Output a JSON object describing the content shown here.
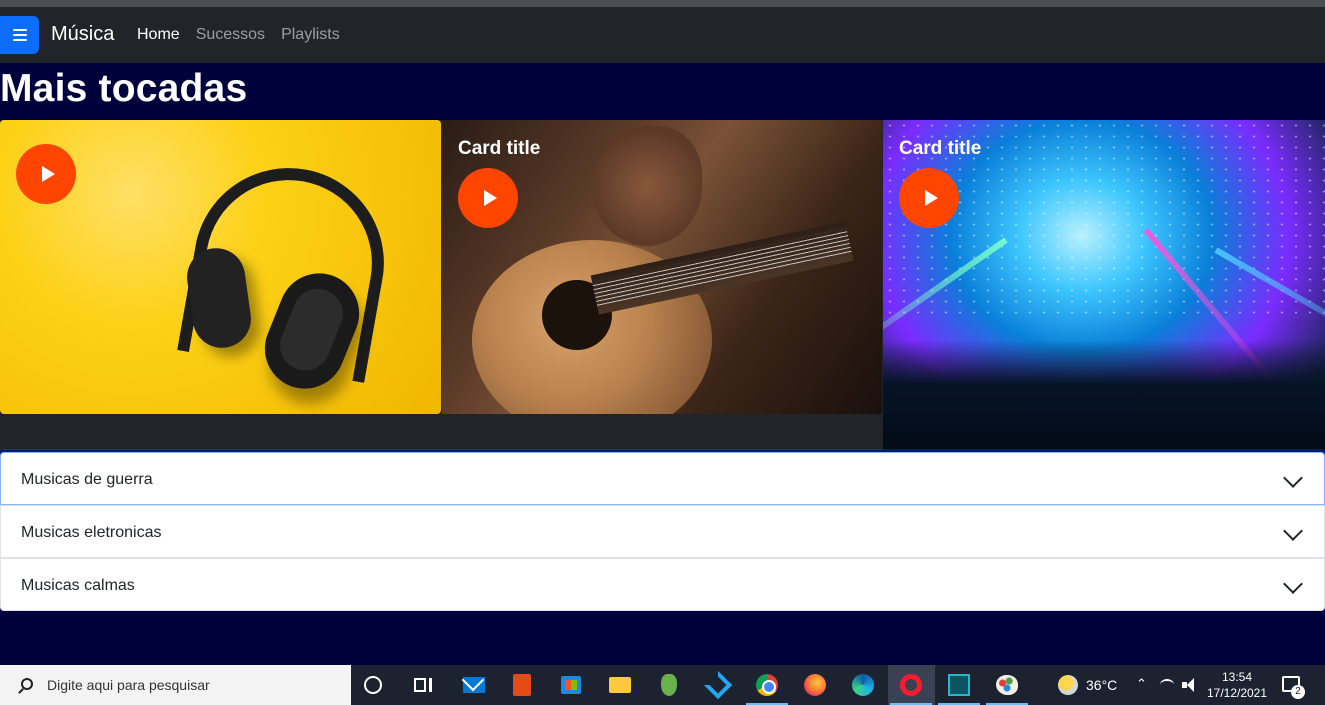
{
  "navbar": {
    "brand": "Música",
    "links": [
      {
        "label": "Home",
        "active": true
      },
      {
        "label": "Sucessos",
        "active": false
      },
      {
        "label": "Playlists",
        "active": false
      }
    ],
    "menu_icon": "hamburger-icon",
    "accent": "#0d6efd"
  },
  "main": {
    "title": "Mais tocadas",
    "cards": [
      {
        "title": "",
        "image": "headphones-image",
        "play_icon": "play-icon"
      },
      {
        "title": "Card title",
        "image": "guitar-image",
        "play_icon": "play-icon"
      },
      {
        "title": "Card title",
        "image": "concert-image",
        "play_icon": "play-icon"
      }
    ],
    "play_color": "#ff4500"
  },
  "accordion": {
    "items": [
      {
        "label": "Musicas de guerra",
        "icon": "chevron-down-icon"
      },
      {
        "label": "Musicas eletronicas",
        "icon": "chevron-down-icon"
      },
      {
        "label": "Musicas calmas",
        "icon": "chevron-down-icon"
      }
    ]
  },
  "taskbar": {
    "search_placeholder": "Digite aqui para pesquisar",
    "apps": [
      "cortana-icon",
      "task-view-icon",
      "mail-icon",
      "office-icon",
      "store-icon",
      "file-explorer-icon",
      "footprint-app-icon",
      "vscode-icon",
      "chrome-icon",
      "firefox-icon",
      "edge-icon",
      "opera-icon",
      "pycharm-icon",
      "paint-icon"
    ],
    "weather": "36°C",
    "time": "13:54",
    "date": "17/12/2021",
    "notifications": "2"
  }
}
